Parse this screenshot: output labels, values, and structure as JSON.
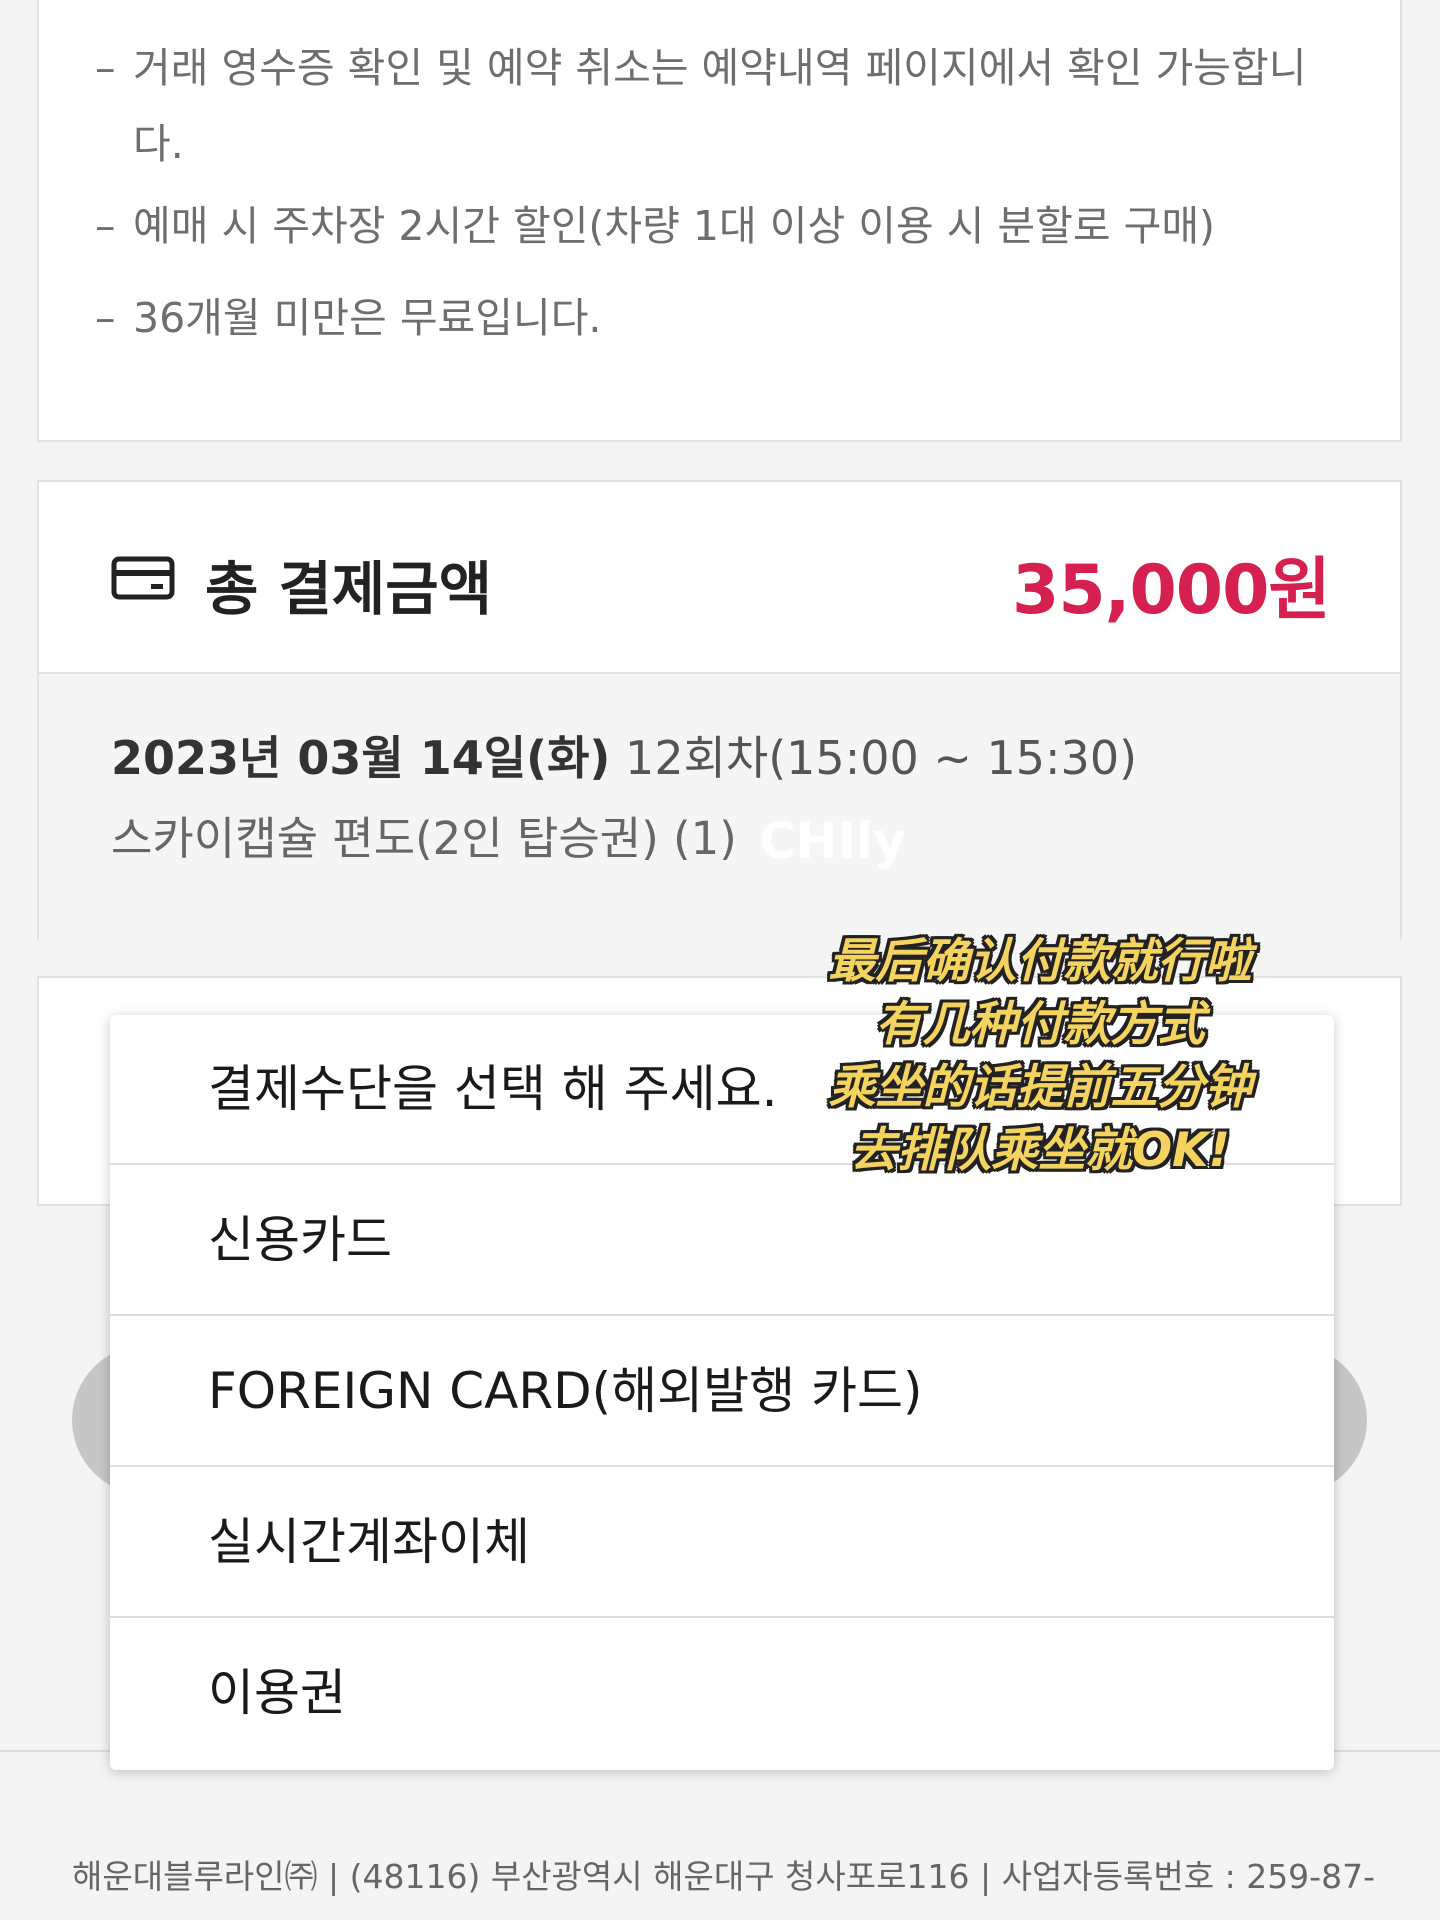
{
  "notices": [
    {
      "dash": "–",
      "text": "거래 영수증 확인 및 예약 취소는 예약내역 페이지에서 확인 가능합니다."
    },
    {
      "dash": "–",
      "text": "예매 시 주차장 2시간 할인(차량 1대 이상 이용 시 분할로 구매)"
    },
    {
      "dash": "–",
      "text": "36개월 미만은 무료입니다."
    }
  ],
  "total": {
    "icon": "credit-card-icon",
    "label": "총 결제금액",
    "amount": "35,000원",
    "accent_color": "#d6204f"
  },
  "booking": {
    "date": "2023년 03월 14일(화)",
    "session": "12회차(15:00 ~ 15:30)",
    "product": "스카이캡슐 편도(2인 탑승권) (1)"
  },
  "watermark": "CHIly",
  "payment_dropdown": {
    "options": [
      "결제수단을 선택 해 주세요.",
      "신용카드",
      "FOREIGN CARD(해외발행 카드)",
      "실시간계좌이체",
      "이용권"
    ]
  },
  "annotation": {
    "lines": [
      "最后确认付款就行啦",
      "有几种付款方式",
      "乘坐的话提前五分钟",
      "去排队乘坐就OK!"
    ]
  },
  "footer": {
    "text": "해운대블루라인㈜ | (48116) 부산광역시 해운대구 청사포로116 | 사업자등록번호 : 259-87-"
  }
}
